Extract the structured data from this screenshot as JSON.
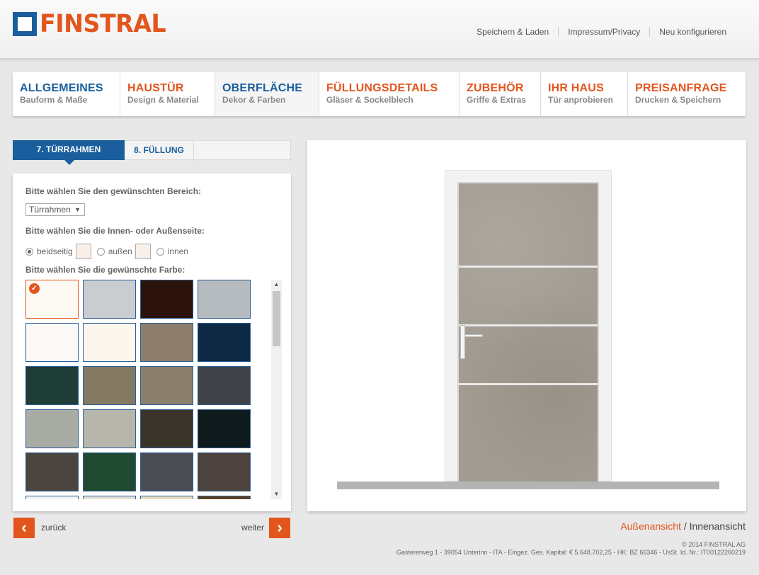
{
  "header": {
    "logo_text": "FINSTRAL",
    "links": [
      "Speichern & Laden",
      "Impressum/Privacy",
      "Neu konfigurieren"
    ]
  },
  "nav": [
    {
      "title": "ALLGEMEINES",
      "subtitle": "Bauform & Maße",
      "color": "#1a5e9d"
    },
    {
      "title": "HAUSTÜR",
      "subtitle": "Design & Material",
      "color": "#e2561e"
    },
    {
      "title": "OBERFLÄCHE",
      "subtitle": "Dekor & Farben",
      "color": "#1a5e9d",
      "active": true
    },
    {
      "title": "FÜLLUNGSDETAILS",
      "subtitle": "Gläser & Sockelblech",
      "color": "#e2561e"
    },
    {
      "title": "ZUBEHÖR",
      "subtitle": "Griffe & Extras",
      "color": "#e2561e"
    },
    {
      "title": "IHR HAUS",
      "subtitle": "Tür anprobieren",
      "color": "#e2561e"
    },
    {
      "title": "PREISANFRAGE",
      "subtitle": "Drucken & Speichern",
      "color": "#e2561e"
    }
  ],
  "subtabs": {
    "active": "7. TÜRRAHMEN",
    "inactive": "8. FÜLLUNG"
  },
  "panel": {
    "area_label": "Bitte wählen Sie den gewünschten Bereich:",
    "area_value": "Türrahmen",
    "side_label": "Bitte wählen Sie die Innen- oder Außenseite:",
    "sides": [
      {
        "label": "beidseitig",
        "checked": true
      },
      {
        "label": "außen",
        "checked": false
      },
      {
        "label": "innen",
        "checked": false
      }
    ],
    "color_label": "Bitte wählen Sie die gewünschte Farbe:",
    "selected_swatch": 0,
    "swatch_colors": [
      "#fcf8f4",
      "#c9cdd0",
      "#2b120b",
      "#b5bbbf",
      "#fbf9f6",
      "#fdf6ee",
      "#8d7e6c",
      "#0f2a45",
      "#1d3d36",
      "#847a64",
      "#8a7f6d",
      "#3f4347",
      "#a9aca5",
      "#b7b6ac",
      "#3a342a",
      "#0f1a1c",
      "#4a453e",
      "#1f4a32",
      "#4b4d55",
      "#4c423e",
      "#f3f3f3",
      "#e6e2d8",
      "#e8dfc2",
      "#5a4322"
    ]
  },
  "footer_nav": {
    "back_label": "zurück",
    "forward_label": "weiter",
    "back_icon": "chevron-left-icon",
    "forward_icon": "chevron-right-icon"
  },
  "view_switch": {
    "active": "Außenansicht",
    "separator": "/",
    "inactive": "Innenansicht"
  },
  "copyright": "© 2014 FINSTRAL AG",
  "address": "Gastererweg 1 - 39054 Unterinn - ITA - Eingez. Ges. Kapital: € 5.648.702,25 - HK: BZ 66346 - UsSt. Id. Nr.: IT00122260219",
  "colors": {
    "brand_blue": "#1a5e9d",
    "brand_orange": "#e2561e",
    "door_color": "#a39c92"
  }
}
